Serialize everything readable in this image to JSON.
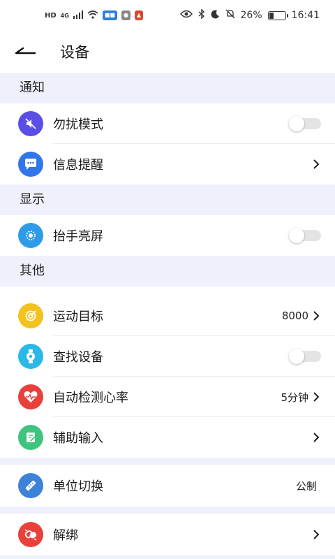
{
  "status_bar": {
    "left_icons": [
      "HD",
      "4G",
      "signal-icon",
      "wifi-icon"
    ],
    "right_icons": [
      "eye-icon",
      "bluetooth-icon",
      "moon-icon",
      "mute-bell-icon"
    ],
    "battery": "26%",
    "battery_level": 0.26,
    "time": "16:41"
  },
  "header": {
    "back_icon": "back-arrow-icon",
    "title": "设备"
  },
  "sections": {
    "notify": "通知",
    "display": "显示",
    "other": "其他"
  },
  "rows": {
    "dnd": {
      "label": "勿扰模式",
      "icon": "mute-speaker-icon",
      "color": "#5b4ee6",
      "toggle_on": false
    },
    "message": {
      "label": "信息提醒",
      "icon": "chat-bubble-icon",
      "color": "#2f76e8"
    },
    "raise": {
      "label": "抬手亮屏",
      "icon": "sun-icon",
      "color": "#2e9be8",
      "toggle_on": false
    },
    "goal": {
      "label": "运动目标",
      "value": "8000",
      "icon": "target-icon",
      "color": "#f3c21e"
    },
    "find": {
      "label": "查找设备",
      "icon": "watch-icon",
      "color": "#2ab8e6",
      "toggle_on": false
    },
    "heart": {
      "label": "自动检测心率",
      "value": "5分钟",
      "icon": "heart-pulse-icon",
      "color": "#e8403a"
    },
    "input": {
      "label": "辅助输入",
      "icon": "edit-doc-icon",
      "color": "#3ec47e"
    },
    "unit": {
      "label": "单位切换",
      "value": "公制",
      "icon": "ruler-icon",
      "color": "#3b82d8"
    },
    "unbind": {
      "label": "解绑",
      "icon": "unlink-icon",
      "color": "#e8403a"
    }
  }
}
